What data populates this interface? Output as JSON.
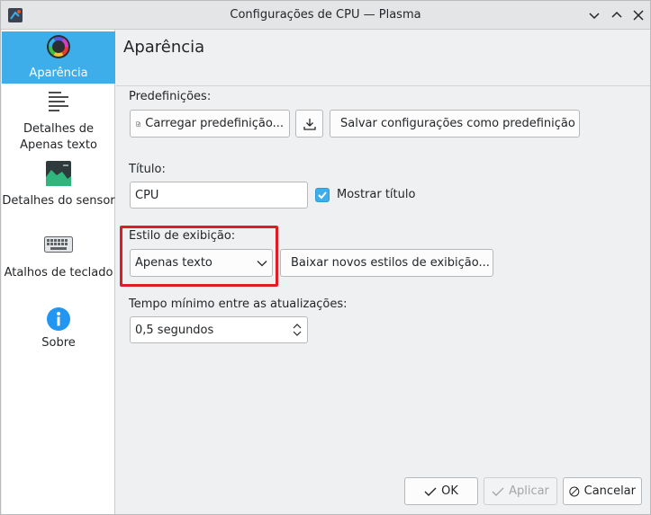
{
  "window": {
    "title": "Configurações de CPU — Plasma"
  },
  "sidebar": {
    "items": [
      {
        "label": "Aparência",
        "icon": "color-wheel-icon",
        "active": true
      },
      {
        "label": "Detalhes de Apenas texto",
        "icon": "text-lines-icon",
        "active": false
      },
      {
        "label": "Detalhes do sensor",
        "icon": "sensor-graph-icon",
        "active": false
      },
      {
        "label": "Atalhos de teclado",
        "icon": "keyboard-icon",
        "active": false
      },
      {
        "label": "Sobre",
        "icon": "info-icon",
        "active": false
      }
    ]
  },
  "main": {
    "page_title": "Aparência",
    "presets": {
      "label": "Predefinições:",
      "load_button": "Carregar predefinição...",
      "save_button": "Salvar configurações como predefinição"
    },
    "title_field": {
      "label": "Título:",
      "value": "CPU",
      "show_title_label": "Mostrar título",
      "show_title_checked": true
    },
    "display_style": {
      "label": "Estilo de exibição:",
      "selected": "Apenas texto",
      "download_button": "Baixar novos estilos de exibição..."
    },
    "update_interval": {
      "label": "Tempo mínimo entre as atualizações:",
      "value": "0,5 segundos"
    }
  },
  "footer": {
    "ok": "OK",
    "apply": "Aplicar",
    "cancel": "Cancelar"
  },
  "colors": {
    "accent": "#3daee9",
    "highlight": "#e01b24"
  }
}
